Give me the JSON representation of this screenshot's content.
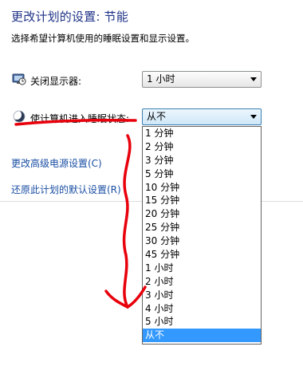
{
  "header": {
    "title": "更改计划的设置: 节能",
    "subtitle": "选择希望计算机使用的睡眠设置和显示设置。"
  },
  "settings": {
    "display": {
      "label": "关闭显示器:",
      "value": "1 小时",
      "icon": "monitor-clock-icon"
    },
    "sleep": {
      "label": "使计算机进入睡眠状态:",
      "value": "从不",
      "icon": "moon-icon",
      "options": [
        "1 分钟",
        "2 分钟",
        "3 分钟",
        "5 分钟",
        "10 分钟",
        "15 分钟",
        "20 分钟",
        "25 分钟",
        "30 分钟",
        "45 分钟",
        "1 小时",
        "2 小时",
        "3 小时",
        "4 小时",
        "5 小时",
        "从不"
      ],
      "selected_index": 15
    }
  },
  "links": {
    "advanced": "更改高级电源设置(C)",
    "restore": "还原此计划的默认设置(R)"
  },
  "colors": {
    "title": "#1e3287",
    "link": "#1a4ea3",
    "selection": "#3399ff",
    "annotation": "#e8000b"
  }
}
